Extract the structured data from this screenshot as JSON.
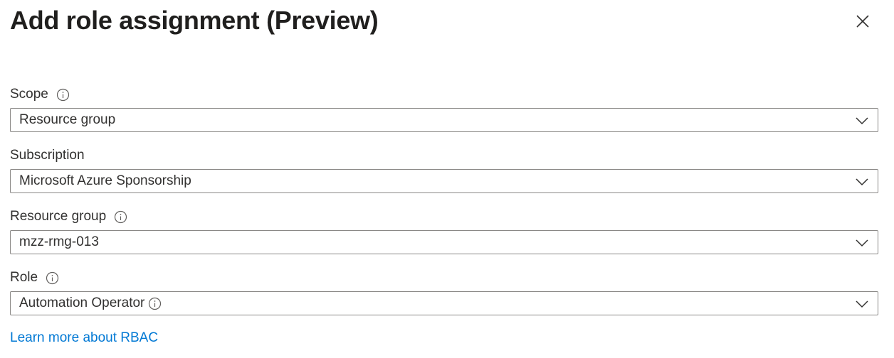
{
  "panel": {
    "title": "Add role assignment (Preview)"
  },
  "fields": {
    "scope": {
      "label": "Scope",
      "value": "Resource group"
    },
    "subscription": {
      "label": "Subscription",
      "value": "Microsoft Azure Sponsorship"
    },
    "resource_group": {
      "label": "Resource group",
      "value": "mzz-rmg-013"
    },
    "role": {
      "label": "Role",
      "value": "Automation Operator"
    }
  },
  "links": {
    "learn_more": "Learn more about RBAC"
  },
  "icons": {
    "close": "close-icon",
    "info": "info-icon",
    "dropdown": "chevron-down-icon"
  },
  "colors": {
    "link": "#0078d4",
    "border": "#8a8886",
    "text": "#323130"
  }
}
